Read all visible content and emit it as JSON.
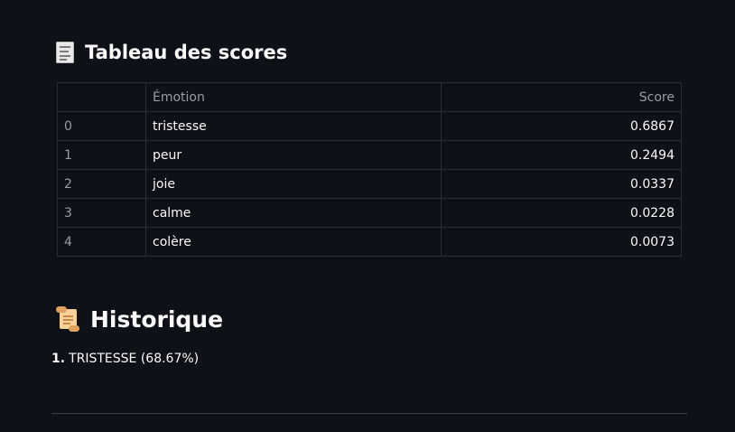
{
  "scores_section": {
    "icon": "receipt-icon",
    "title": "Tableau des scores"
  },
  "table": {
    "columns": [
      "",
      "Émotion",
      "Score"
    ],
    "rows": [
      {
        "index": "0",
        "emotion": "tristesse",
        "score": "0.6867"
      },
      {
        "index": "1",
        "emotion": "peur",
        "score": "0.2494"
      },
      {
        "index": "2",
        "emotion": "joie",
        "score": "0.0337"
      },
      {
        "index": "3",
        "emotion": "calme",
        "score": "0.0228"
      },
      {
        "index": "4",
        "emotion": "colère",
        "score": "0.0073"
      }
    ]
  },
  "history_section": {
    "icon": "scroll-icon",
    "title": "Historique",
    "items": [
      {
        "number": "1.",
        "text": "TRISTESSE (68.67%)"
      }
    ]
  },
  "colors": {
    "background": "#0e1117",
    "text": "#fafafa",
    "muted": "#9a9ca3",
    "border": "#2a2d36"
  }
}
